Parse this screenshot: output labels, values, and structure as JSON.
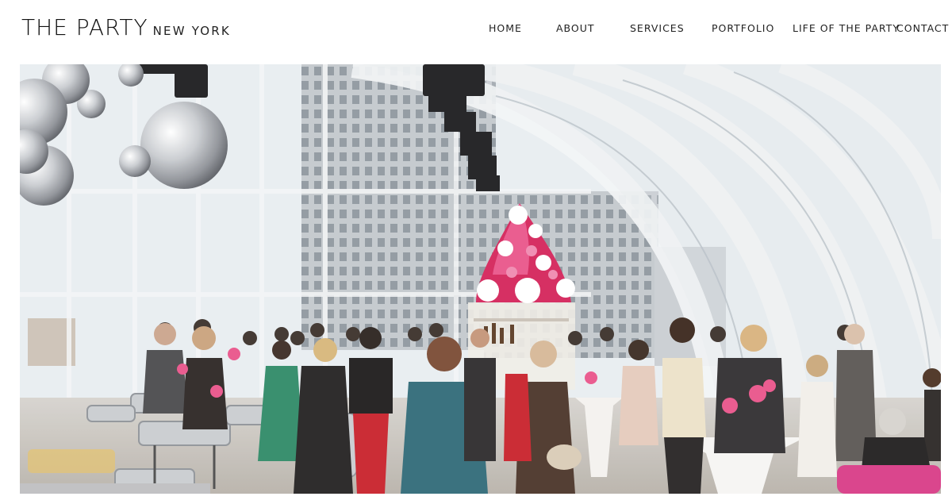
{
  "brand": {
    "name": "THE PARTY",
    "location": "NEW YORK"
  },
  "nav": {
    "items": [
      {
        "key": "home",
        "label": "HOME"
      },
      {
        "key": "about",
        "label": "ABOUT"
      },
      {
        "key": "services",
        "label": "SERVICES"
      },
      {
        "key": "portfolio",
        "label": "PORTFOLIO"
      },
      {
        "key": "life-of-the-party",
        "label": "LIFE OF THE PARTY"
      },
      {
        "key": "contact",
        "label": "CONTACT"
      }
    ]
  },
  "hero": {
    "image_subject": "event-venue-party-photo",
    "accent_colors": {
      "flowers": "#d4245a",
      "sky": "#e9eef2",
      "crowd_dark": "#2a2522",
      "dress_teal": "#2f6a78",
      "pants_red": "#c8202a",
      "chair_pink": "#d83b86"
    }
  }
}
